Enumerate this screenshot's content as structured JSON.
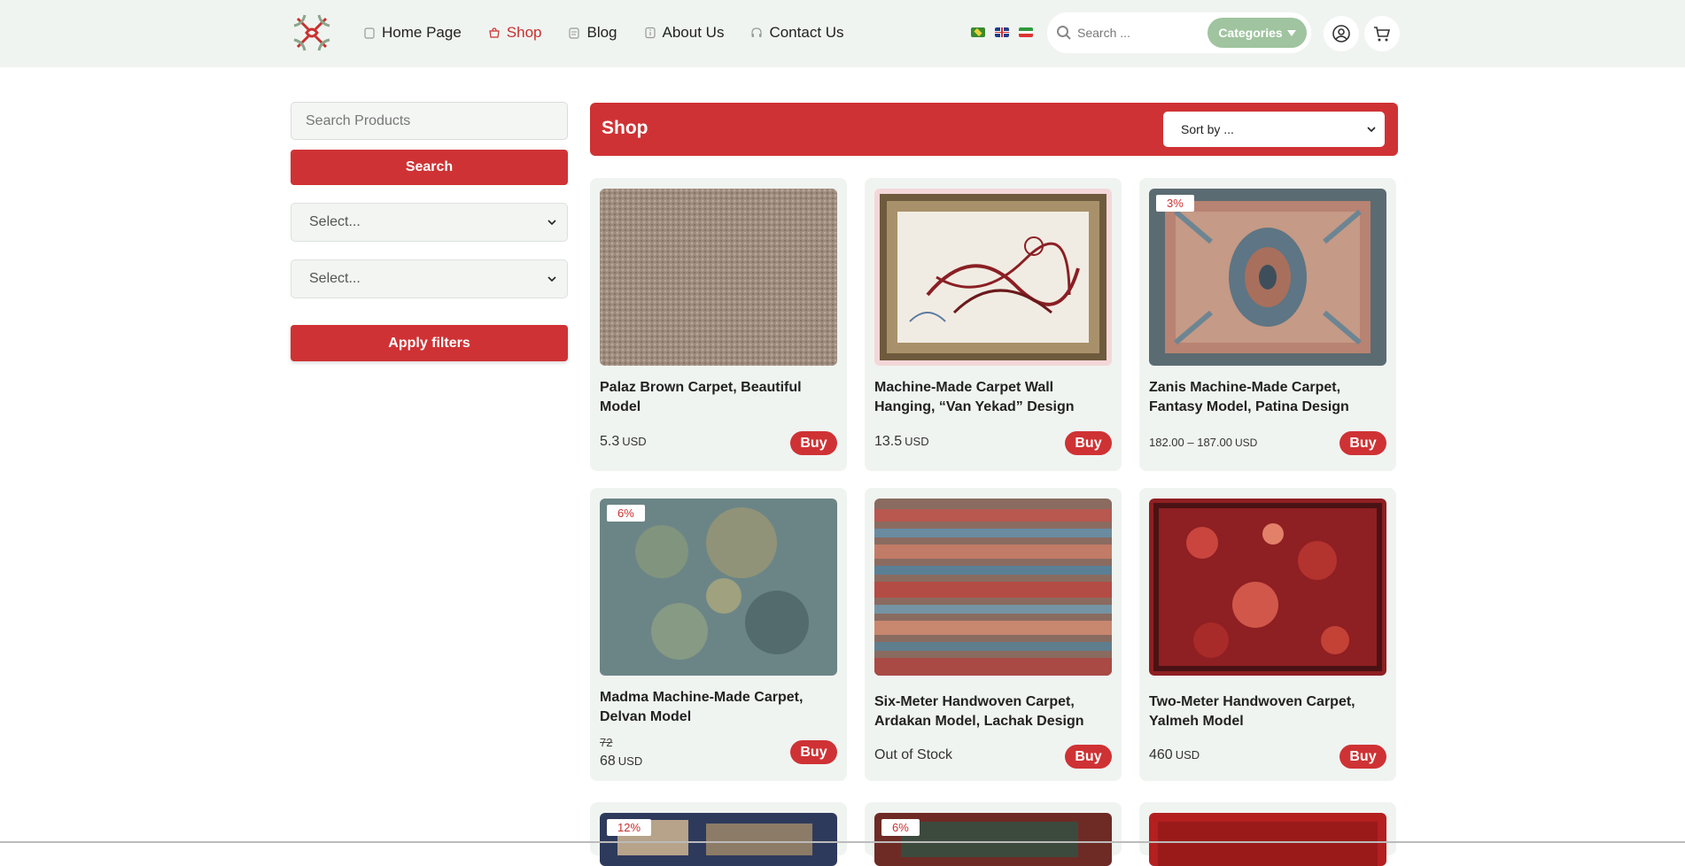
{
  "header": {
    "nav": [
      {
        "label": "Home Page",
        "icon": "home-icon",
        "active": false
      },
      {
        "label": "Shop",
        "icon": "shop-icon",
        "active": true
      },
      {
        "label": "Blog",
        "icon": "blog-icon",
        "active": false
      },
      {
        "label": "About Us",
        "icon": "info-icon",
        "active": false
      },
      {
        "label": "Contact Us",
        "icon": "headset-icon",
        "active": false
      }
    ],
    "search_placeholder": "Search ...",
    "categories_label": "Categories",
    "colors": {
      "bg": "#f0f4f1",
      "accent": "#c9302f",
      "categories": "#9fc49f"
    }
  },
  "sidebar": {
    "search_placeholder": "Search Products",
    "search_button": "Search",
    "select_1": "Select...",
    "select_2": "Select...",
    "apply_button": "Apply filters"
  },
  "shop": {
    "title": "Shop",
    "sort_label": "Sort by ..."
  },
  "products": [
    {
      "title": "Palaz Brown Carpet, Beautiful Model",
      "price": "5.3",
      "currency": "USD",
      "badge": "",
      "old_price": "",
      "buy": "Buy"
    },
    {
      "title": "Machine-Made Carpet Wall Hanging, “Van Yekad” Design",
      "price": "13.5",
      "currency": "USD",
      "badge": "",
      "old_price": "",
      "buy": "Buy"
    },
    {
      "title": "Zanis Machine-Made Carpet, Fantasy Model, Patina Design",
      "price": "182.00 – 187.00",
      "currency": "USD",
      "badge": "3%",
      "old_price": "",
      "buy": "Buy"
    },
    {
      "title": "Madma Machine-Made Carpet, Delvan Model",
      "price": "68",
      "currency": "USD",
      "badge": "6%",
      "old_price": "72",
      "buy": "Buy"
    },
    {
      "title": "Six-Meter Handwoven Carpet, Ardakan Model, Lachak Design",
      "price": "Out of Stock",
      "currency": "",
      "badge": "",
      "old_price": "",
      "buy": "Buy"
    },
    {
      "title": "Two-Meter Handwoven Carpet, Yalmeh Model",
      "price": "460",
      "currency": "USD",
      "badge": "",
      "old_price": "",
      "buy": "Buy"
    }
  ],
  "next_row_badges": [
    "12%",
    "6%",
    ""
  ]
}
